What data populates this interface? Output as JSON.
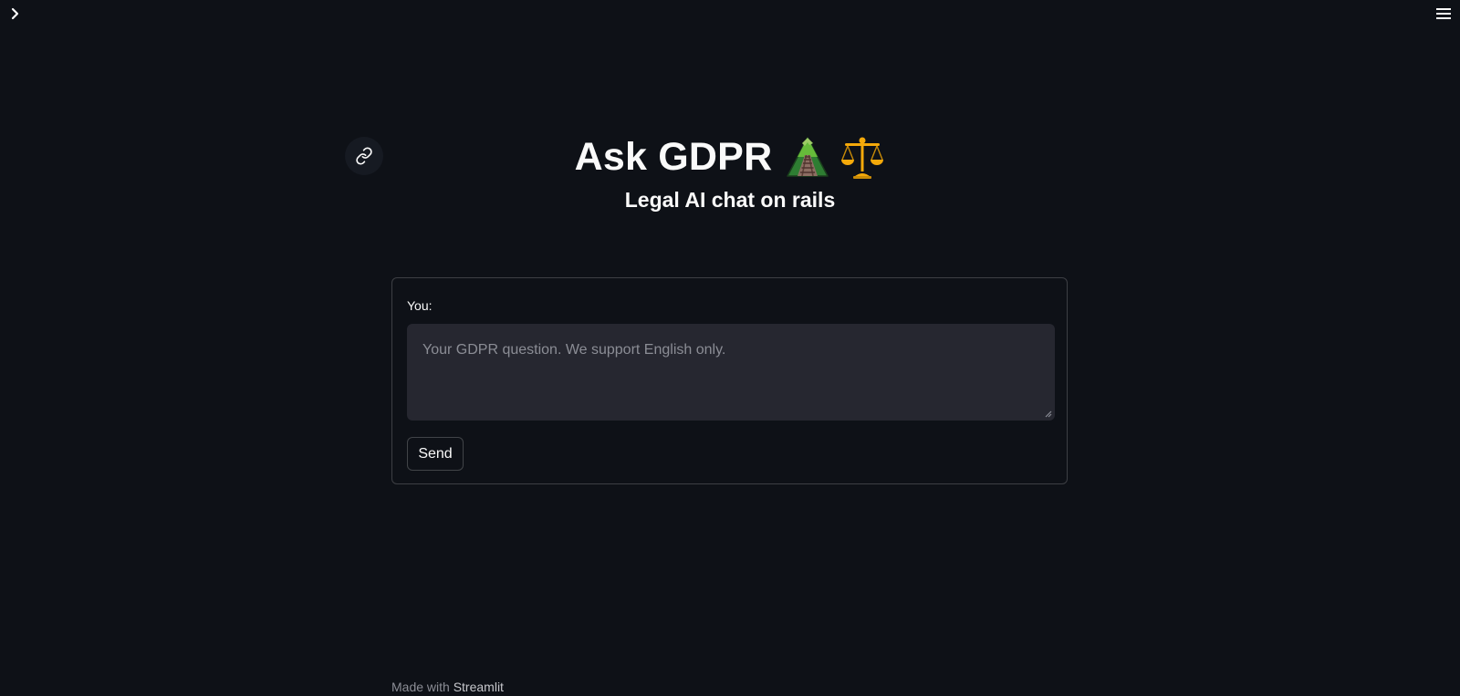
{
  "header": {
    "sidebar_toggle_icon": "chevron-right-icon",
    "menu_icon": "hamburger-menu-icon"
  },
  "hero": {
    "title": "Ask GDPR",
    "title_icons": [
      "mountain-railway-icon",
      "balance-scale-icon"
    ],
    "anchor_icon": "link-icon",
    "subtitle": "Legal AI chat on rails"
  },
  "form": {
    "label": "You:",
    "input_value": "",
    "input_placeholder": "Your GDPR question. We support English only.",
    "send_label": "Send"
  },
  "footer": {
    "prefix": "Made with ",
    "link_text": "Streamlit"
  },
  "colors": {
    "background": "#0e1117",
    "text": "#fafafa",
    "input_background": "#262730",
    "muted_text": "#8b8d95"
  }
}
